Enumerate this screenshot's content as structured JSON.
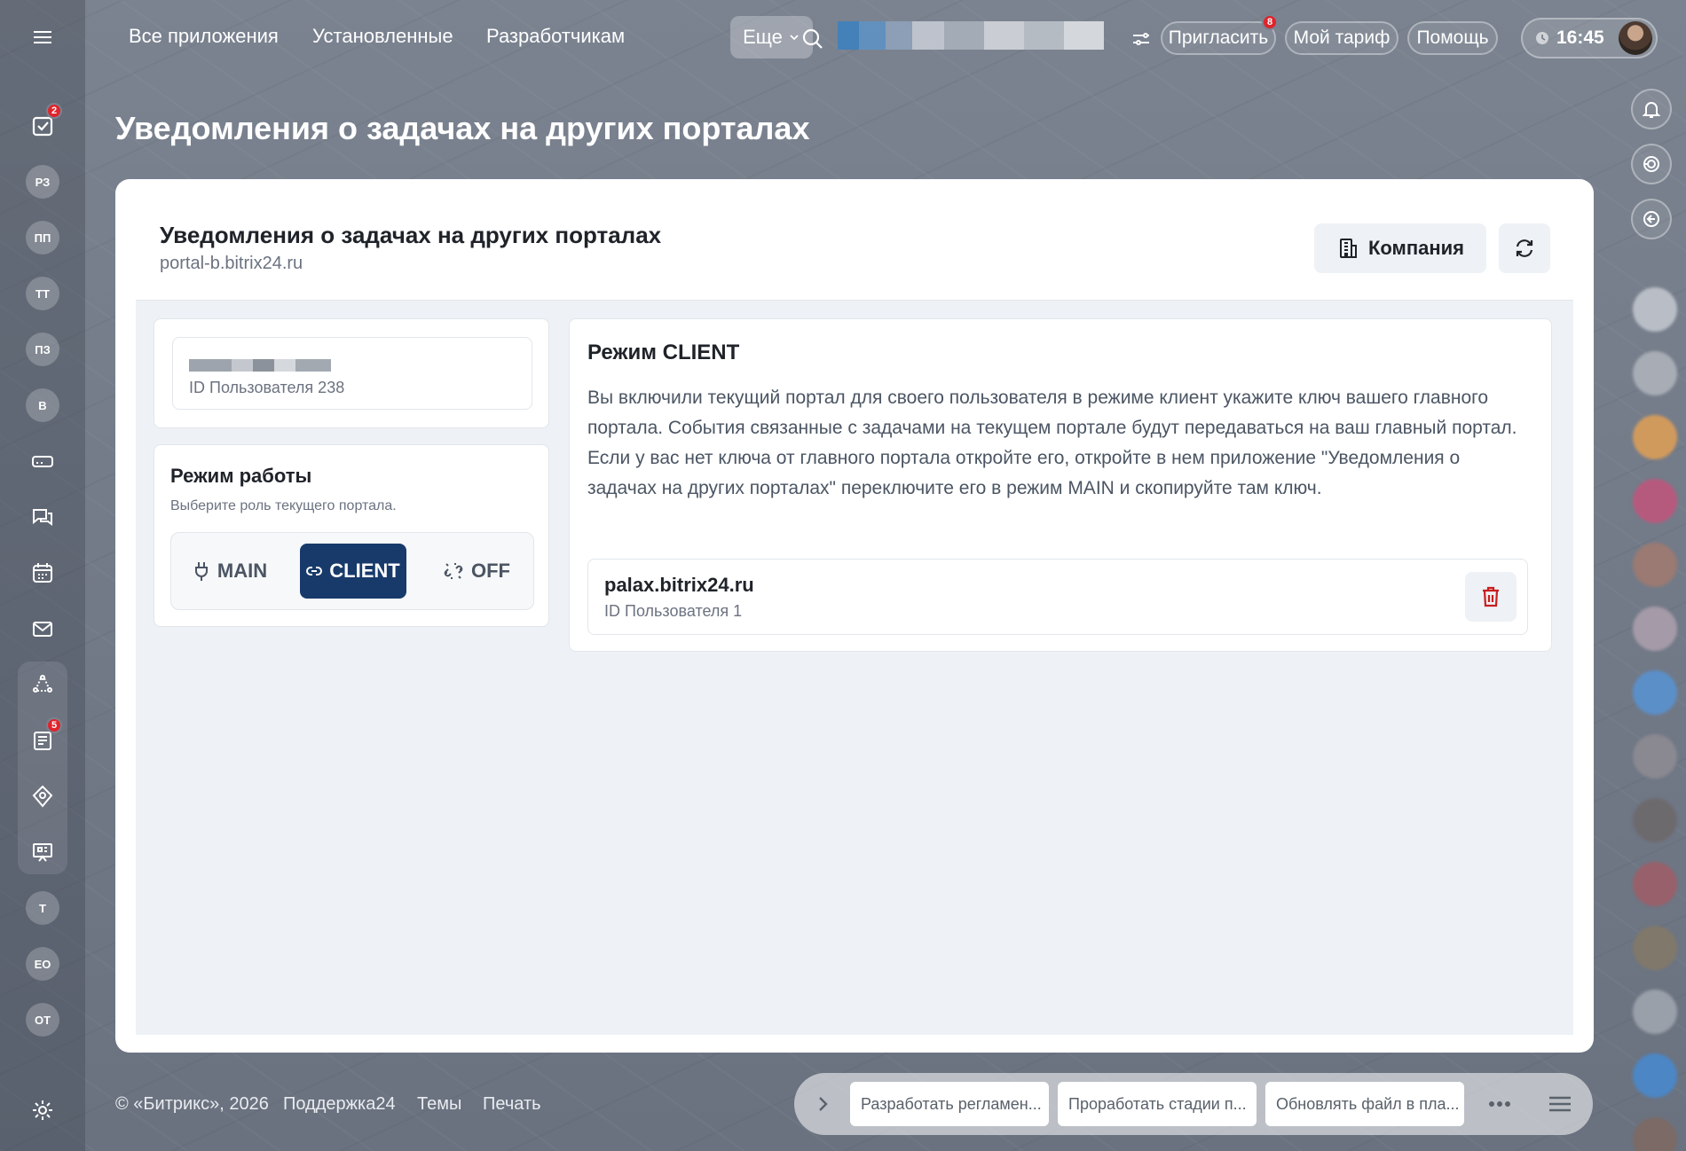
{
  "nav": {
    "links": [
      "Все приложения",
      "Установленные",
      "Разработчикам"
    ],
    "more_label": "Еще",
    "invite_label": "Пригласить",
    "invite_badge": "8",
    "tariff_label": "Мой тариф",
    "help_label": "Помощь",
    "time": "16:45"
  },
  "sidebar": {
    "tasks_badge": "2",
    "groups": [
      "РЗ",
      "ПП",
      "ТТ",
      "ПЗ",
      "В"
    ],
    "feed_badge": "5",
    "bottom_groups": [
      "Т",
      "ЕО",
      "ОТ"
    ]
  },
  "page": {
    "title": "Уведомления о задачах на других порталах"
  },
  "card": {
    "title": "Уведомления о задачах на других порталах",
    "subtitle": "portal-b.bitrix24.ru",
    "company_label": "Компания"
  },
  "user": {
    "id_label": "ID Пользователя 238"
  },
  "mode": {
    "title": "Режим работы",
    "hint": "Выберите роль текущего портала.",
    "options": [
      "MAIN",
      "CLIENT",
      "OFF"
    ],
    "selected": "CLIENT"
  },
  "client": {
    "title": "Режим CLIENT",
    "description": "Вы включили текущий портал для своего пользователя в режиме клиент укажите ключ вашего главного портала. События связанные с задачами на текущем портале будут передаваться на ваш главный портал. Если у вас нет ключа от главного портала откройте его, откройте в нем приложение \"Уведомления о задачах на других порталах\" переключите его в режим MAIN и скопируйте там ключ.",
    "portal": {
      "name": "palax.bitrix24.ru",
      "user_id": "ID Пользователя 1"
    }
  },
  "footer": {
    "copyright": "© «Битрикс», 2026",
    "support": "Поддержка24",
    "themes": "Темы",
    "print": "Печать"
  },
  "taskbar": {
    "items": [
      "Разработать регламен...",
      "Проработать стадии п...",
      "Обновлять файл в пла..."
    ]
  },
  "colors": {
    "accent": "#183a6b",
    "badge": "#e0242c",
    "delete": "#c81e1e"
  }
}
